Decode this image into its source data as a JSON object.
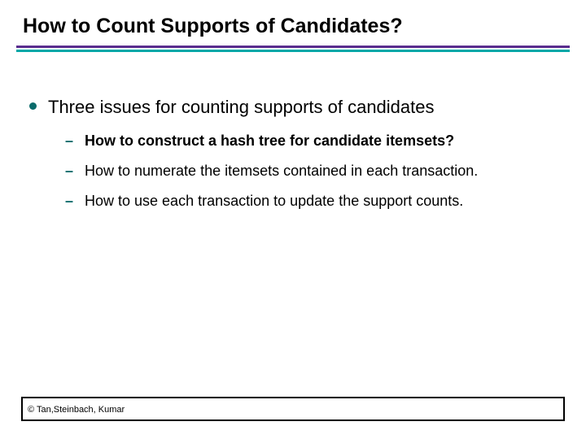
{
  "slide": {
    "title": "How to Count Supports of Candidates?",
    "bullets": {
      "level1": "Three issues for counting supports of candidates",
      "level2": [
        {
          "text": "How to construct a hash tree for candidate itemsets?",
          "bold": true
        },
        {
          "text": "How to numerate the itemsets contained in each transaction.",
          "bold": false
        },
        {
          "text": "How to use each transaction to update the support counts.",
          "bold": false
        }
      ]
    },
    "footer": "© Tan,Steinbach, Kumar"
  },
  "colors": {
    "rule_top": "#5b2d8e",
    "rule_bottom": "#00a7a7",
    "bullet": "#0a6b6b"
  }
}
